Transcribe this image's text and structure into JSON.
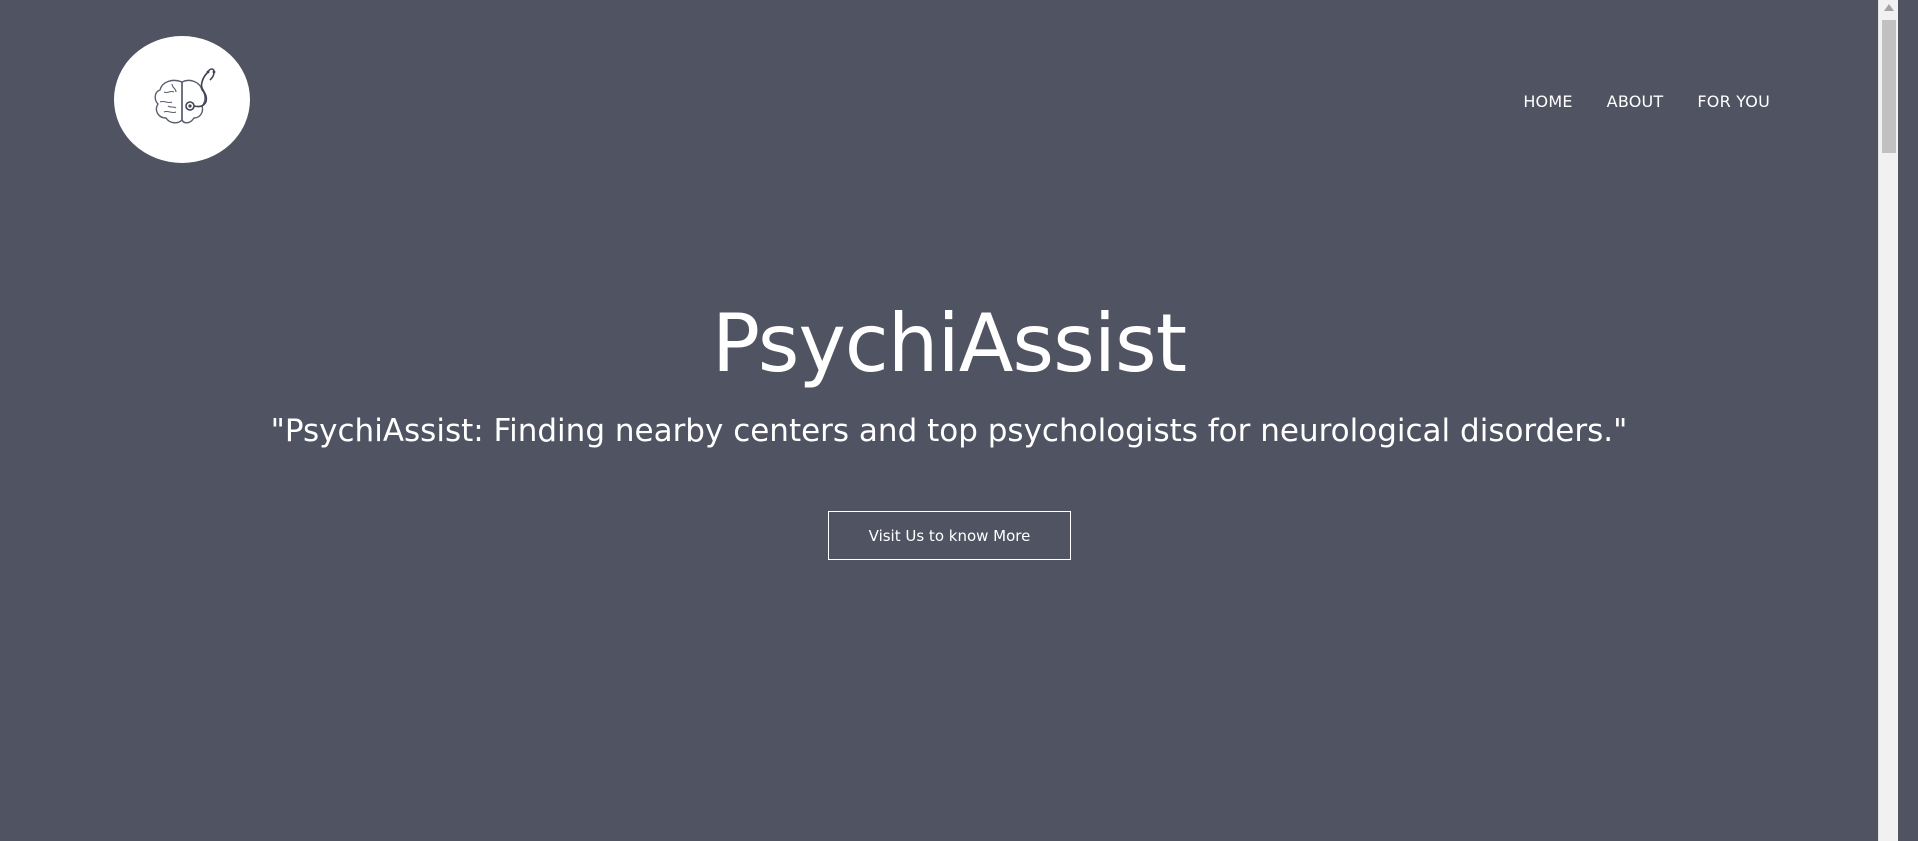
{
  "header": {
    "logo_icon": "brain-stethoscope-icon",
    "nav": [
      {
        "label": "HOME"
      },
      {
        "label": "ABOUT"
      },
      {
        "label": "FOR YOU"
      }
    ]
  },
  "hero": {
    "title": "PsychiAssist",
    "tagline": "\"PsychiAssist: Finding nearby centers and top psychologists for neurological disorders.\"",
    "cta_label": "Visit Us to know More"
  },
  "colors": {
    "background": "#505362",
    "text": "#ffffff",
    "logo_bg": "#ffffff"
  }
}
